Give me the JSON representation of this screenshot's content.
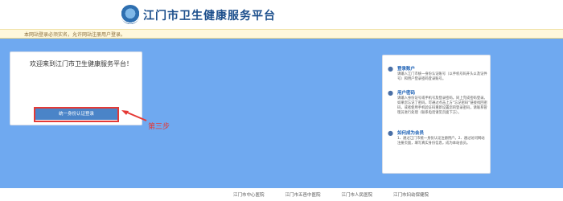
{
  "header": {
    "title": "江门市卫生健康服务平台",
    "logo_icon": "health-emblem-icon"
  },
  "notice": {
    "text": "本网站登录必须实名，允许网站注册用户登录。"
  },
  "welcome": {
    "text": "欢迎来到江门市卫生健康服务平台！",
    "login_button": "统一身份认证登录"
  },
  "annotation": {
    "step_label": "第三步"
  },
  "help": {
    "sections": [
      {
        "icon": "user-icon",
        "title": "登录账户",
        "body": "请输入江门市统一身份认证账号（以手机号码开头以及证件号）和用户登录密码登录账号。"
      },
      {
        "icon": "user-help-icon",
        "title": "用户密码",
        "body": "请输入身份证号或手机号及登录密码，同上完成密码登录。如果您忘记了密码，可通过点击上方“忘记密码”链接找回密码，或者使用手机验证码重新设置您的登录密码，请联系管理员进行处理（联系电话请见页面下方）。"
      },
      {
        "icon": "register-icon",
        "title": "如何成为会员",
        "body": "1、通过江门市统一身份认证注册用户。2、通过访问网站注册页面，填写真实身份信息，成为本站会员。"
      }
    ]
  },
  "footer": {
    "links": [
      "江门市中心医院",
      "江门市五邑中医院",
      "江门市人民医院",
      "江门市妇幼保健院"
    ]
  },
  "colors": {
    "main_bg": "#6fa9f0",
    "accent": "#e53935",
    "button": "#4a84c8"
  }
}
